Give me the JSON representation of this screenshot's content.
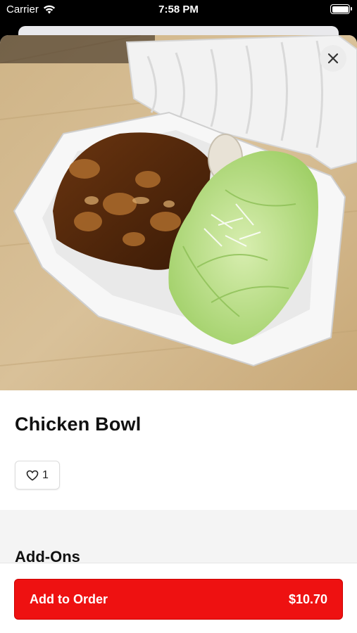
{
  "status_bar": {
    "carrier": "Carrier",
    "time": "7:58 PM"
  },
  "item": {
    "title": "Chicken Bowl",
    "like_count": "1",
    "image_description_icon": "food-photo"
  },
  "sections": {
    "addons_title": "Add-Ons"
  },
  "footer": {
    "button_label": "Add to Order",
    "price": "$10.70"
  },
  "colors": {
    "accent": "#ee1111",
    "section_bg": "#f4f4f4"
  }
}
